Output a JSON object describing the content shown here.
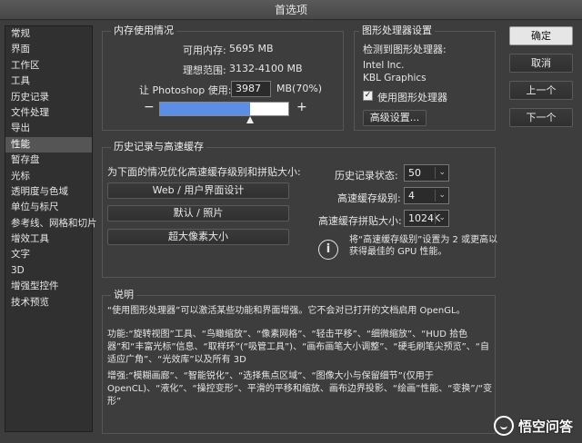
{
  "window": {
    "title": "首选项"
  },
  "sidebar": {
    "items": [
      "常规",
      "界面",
      "工作区",
      "工具",
      "历史记录",
      "文件处理",
      "导出",
      "性能",
      "暂存盘",
      "光标",
      "透明度与色域",
      "单位与标尺",
      "参考线、网格和切片",
      "增效工具",
      "文字",
      "3D",
      "增强型控件",
      "技术预览"
    ],
    "selected_index": 7
  },
  "memory": {
    "title": "内存使用情况",
    "available_label": "可用内存:",
    "available_value": "5695 MB",
    "ideal_label": "理想范围:",
    "ideal_value": "3132-4100 MB",
    "let_label": "让 Photoshop 使用:",
    "let_value": "3987",
    "let_unit": "MB(70%)",
    "slider_percent": 70,
    "minus": "−",
    "plus": "+"
  },
  "gpu": {
    "title": "图形处理器设置",
    "detected_label": "检测到图形处理器:",
    "vendor": "Intel Inc.",
    "model": "KBL Graphics",
    "use_gpu_label": "使用图形处理器",
    "use_gpu_checked": "✓",
    "advanced_button": "高级设置..."
  },
  "buttons": {
    "ok": "确定",
    "cancel": "取消",
    "prev": "上一个",
    "next": "下一个"
  },
  "history": {
    "title": "历史记录与高速缓存",
    "optimize_label": "为下面的情况优化高速缓存级别和拼贴大小:",
    "preset_web": "Web / 用户界面设计",
    "preset_default": "默认 / 照片",
    "preset_huge": "超大像素大小",
    "states_label": "历史记录状态:",
    "states_value": "50",
    "levels_label": "高速缓存级别:",
    "levels_value": "4",
    "tile_label": "高速缓存拼贴大小:",
    "tile_value": "1024K",
    "info_icon": "i",
    "info_text": "将“高速缓存级别”设置为 2 或更高以获得最佳的 GPU 性能。"
  },
  "description": {
    "title": "说明",
    "p1": "“使用图形处理器”可以激活某些功能和界面增强。它不会对已打开的文档启用 OpenGL。",
    "p2": "功能:“旋转视图”工具、“鸟瞰缩放”、“像素网格”、“轻击平移”、“细微缩放”、“HUD 拾色器”和“丰富光标”信息、“取样环”(“吸管工具”)、“画布画笔大小调整”、“硬毛刷笔尖预览”、“自适应广角”、“光效库”以及所有 3D",
    "p3": "增强:“模糊画廊”、“智能锐化”、“选择焦点区域”、“图像大小与保留细节”(仅用于 OpenCL)、“液化”、“操控变形”、平滑的平移和缩放、画布边界投影、“绘画”性能、“变换”/“变形”"
  },
  "watermark": {
    "text": "悟空问答"
  }
}
